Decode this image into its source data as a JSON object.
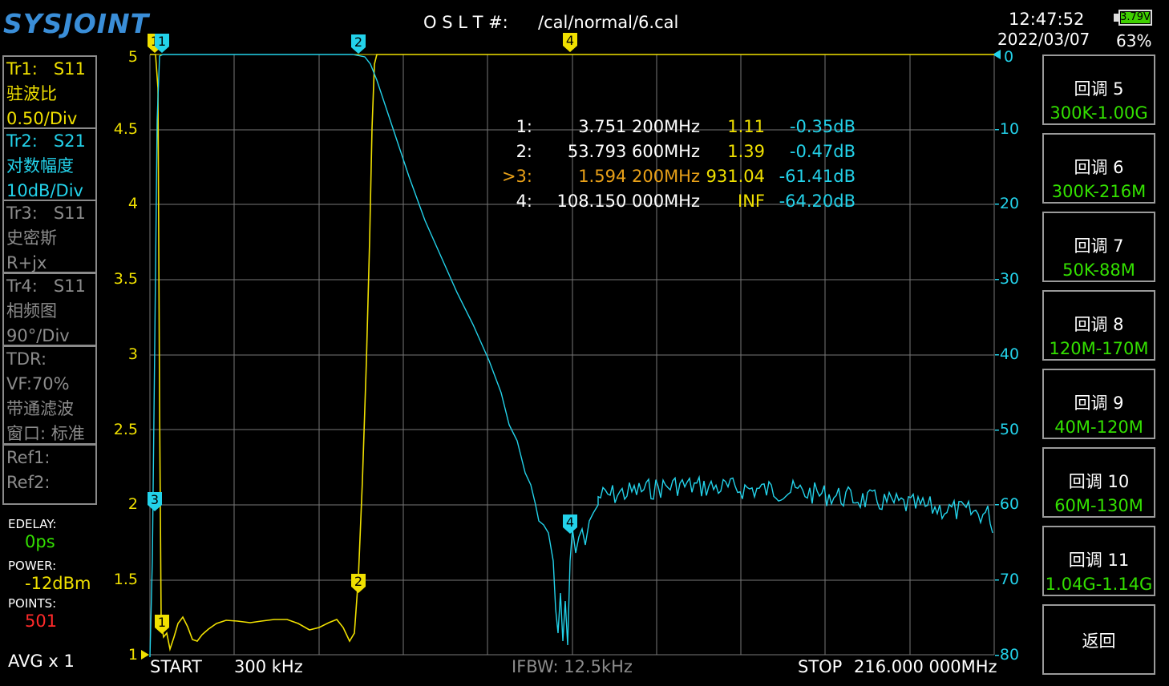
{
  "header": {
    "logo": "SYSJOINT",
    "cal_label": "O S L T #:",
    "cal_file": "/cal/normal/6.cal",
    "time": "12:47:52",
    "date": "2022/03/07",
    "battery_voltage": "3.79V",
    "battery_percent": "63%"
  },
  "traces": [
    {
      "name": "Tr1:",
      "param": "S11",
      "format": "驻波比",
      "scale": "0.50/Div",
      "color": "#f0e000"
    },
    {
      "name": "Tr2:",
      "param": "S21",
      "format": "对数幅度",
      "scale": "10dB/Div",
      "color": "#23d2ea"
    },
    {
      "name": "Tr3:",
      "param": "S11",
      "format": "史密斯",
      "scale": "R+jx",
      "color": "#8c8c8c"
    },
    {
      "name": "Tr4:",
      "param": "S11",
      "format": "相频图",
      "scale": "90°/Div",
      "color": "#8c8c8c"
    }
  ],
  "tdr": {
    "label": "TDR:",
    "vf": "VF:70%",
    "mode": "带通滤波",
    "window": "窗口: 标准"
  },
  "refs": {
    "ref1": "Ref1:",
    "ref2": "Ref2:"
  },
  "settings": {
    "edelay_label": "EDELAY:",
    "edelay_value": "0ps",
    "power_label": "POWER:",
    "power_value": "-12dBm",
    "points_label": "POINTS:",
    "points_value": "501",
    "avg": "AVG x 1"
  },
  "left_axis": [
    "5",
    "4.5",
    "4",
    "3.5",
    "3",
    "2.5",
    "2",
    "1.5",
    "1"
  ],
  "right_axis": [
    "0",
    "-10",
    "-20",
    "-30",
    "-40",
    "-50",
    "-60",
    "-70",
    "-80"
  ],
  "markers": [
    {
      "id": "1:",
      "freq": "3.751 200MHz",
      "swr": "1.11",
      "db": "-0.35dB",
      "active": false
    },
    {
      "id": "2:",
      "freq": "53.793 600MHz",
      "swr": "1.39",
      "db": "-0.47dB",
      "active": false
    },
    {
      "id": ">3:",
      "freq": "1.594 200MHz",
      "swr": "931.04",
      "db": "-61.41dB",
      "active": true
    },
    {
      "id": "4:",
      "freq": "108.150 000MHz",
      "swr": "INF",
      "db": "-64.20dB",
      "active": false
    }
  ],
  "marker_flags": {
    "m1": "1",
    "m2": "2",
    "m3": "3",
    "m4": "4"
  },
  "menu": [
    {
      "title": "回调 5",
      "range": "300K-1.00G"
    },
    {
      "title": "回调 6",
      "range": "300K-216M"
    },
    {
      "title": "回调 7",
      "range": "50K-88M"
    },
    {
      "title": "回调 8",
      "range": "120M-170M"
    },
    {
      "title": "回调 9",
      "range": "40M-120M"
    },
    {
      "title": "回调 10",
      "range": "60M-130M"
    },
    {
      "title": "回调 11",
      "range": "1.04G-1.14G"
    }
  ],
  "back_label": "返回",
  "footer": {
    "start_label": "START",
    "start_value": "300 kHz",
    "ifbw": "IFBW: 12.5kHz",
    "stop_label": "STOP",
    "stop_value": "216.000 000MHz"
  },
  "colors": {
    "trace1": "#f0e000",
    "trace2": "#23d2ea",
    "active_marker": "#e8a018",
    "menu_value": "#33e000"
  }
}
